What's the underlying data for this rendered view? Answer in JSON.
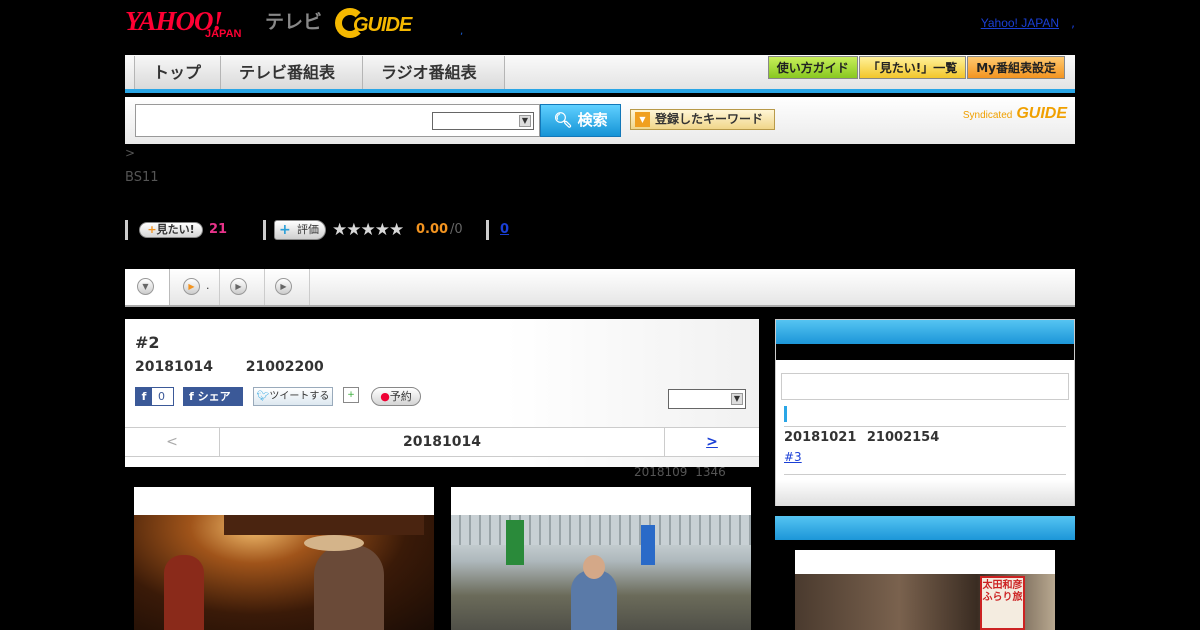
{
  "header": {
    "yahoo": "YAHOO!",
    "japan": "JAPAN",
    "tv": "テレビ",
    "gguide": "GUIDE",
    "dot": ",",
    "yj_link": "Yahoo! JAPAN",
    "yj_sep": ","
  },
  "nav": {
    "tabs": [
      "トップ",
      "テレビ番組表",
      "ラジオ番組表"
    ],
    "buttons": [
      "使い方ガイド",
      "「見たい!」一覧",
      "My番組表設定"
    ]
  },
  "search": {
    "input_value": "",
    "select_value": "",
    "button_label": "検索",
    "keyword_button": "登録したキーワード",
    "syndicated": "Syndicated",
    "syndicated_logo": "GUIDE"
  },
  "breadcrumb": ">",
  "station": "BS11",
  "stats": {
    "mitai_label": "見たい!",
    "mitai_count": "21",
    "hyoka_label": "評価",
    "stars": "★★★★★",
    "score": "0.00",
    "score_den": "/0",
    "reviews": "0"
  },
  "tabs": {
    "tab2_label": "."
  },
  "program": {
    "title": "#2",
    "date": "20181014 21002200",
    "fb_count": "0",
    "fb_share": "シェア",
    "tweet": "ツイートする",
    "reserve": "予約",
    "select_value": ""
  },
  "pager": {
    "prev": "<",
    "current": "20181014",
    "next": ">"
  },
  "updated": "2018109 1346",
  "sidebar": {
    "next_date": "20181021 21002154",
    "next_title": "#3"
  },
  "sidebar2": {
    "sign_text": "太田和彦 ふらり旅"
  }
}
